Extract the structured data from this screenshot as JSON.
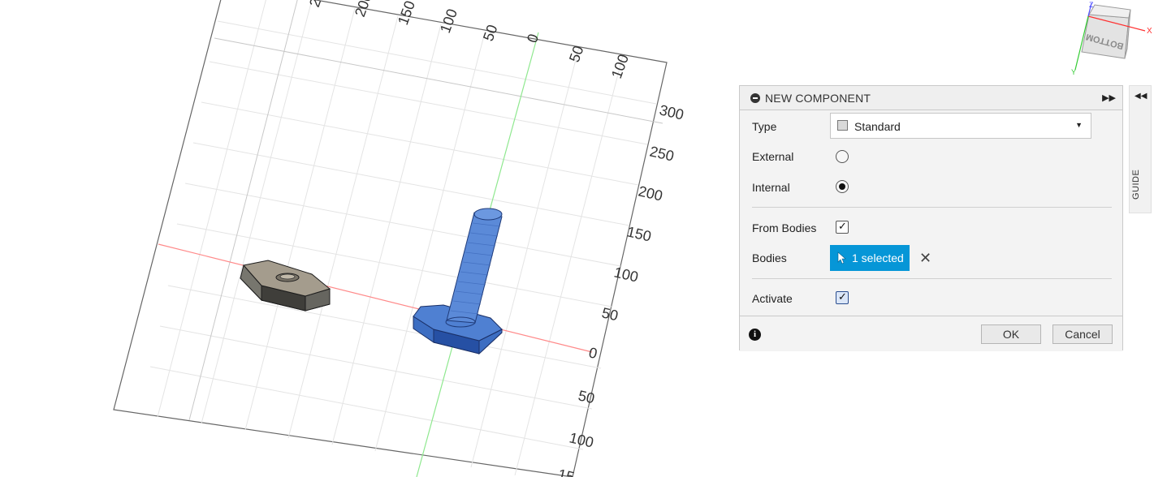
{
  "viewport": {
    "top_axis_ticks": [
      "2",
      "200",
      "150",
      "100",
      "50",
      "0",
      "50",
      "100"
    ],
    "right_axis_ticks": [
      "300",
      "250",
      "200",
      "150",
      "100",
      "50",
      "0",
      "50",
      "100",
      "15"
    ]
  },
  "viewcube": {
    "face_label": "BOTTOM",
    "axis_x": "X",
    "axis_z": "Z",
    "axis_y": "Y"
  },
  "dialog": {
    "title": "NEW COMPONENT",
    "type_label": "Type",
    "type_value": "Standard",
    "external_label": "External",
    "internal_label": "Internal",
    "from_bodies_label": "From Bodies",
    "bodies_label": "Bodies",
    "bodies_selection": "1 selected",
    "activate_label": "Activate",
    "ok_label": "OK",
    "cancel_label": "Cancel",
    "external_checked": false,
    "internal_checked": true,
    "from_bodies_checked": true,
    "activate_checked": true
  },
  "guide_tab": {
    "label": "GUIDE"
  },
  "colors": {
    "selected_body": "#4a7fd0",
    "selection_button": "#0696d7",
    "x_axis_line": "#ff8080",
    "y_axis_line": "#80e080",
    "grid_line": "#e6e6e6"
  },
  "icons": [
    "collapse-minus-icon",
    "expand-arrows-icon",
    "component-cube-icon",
    "dropdown-caret-icon",
    "cursor-pointer-icon",
    "clear-x-icon",
    "info-icon",
    "collapse-arrows-icon"
  ]
}
